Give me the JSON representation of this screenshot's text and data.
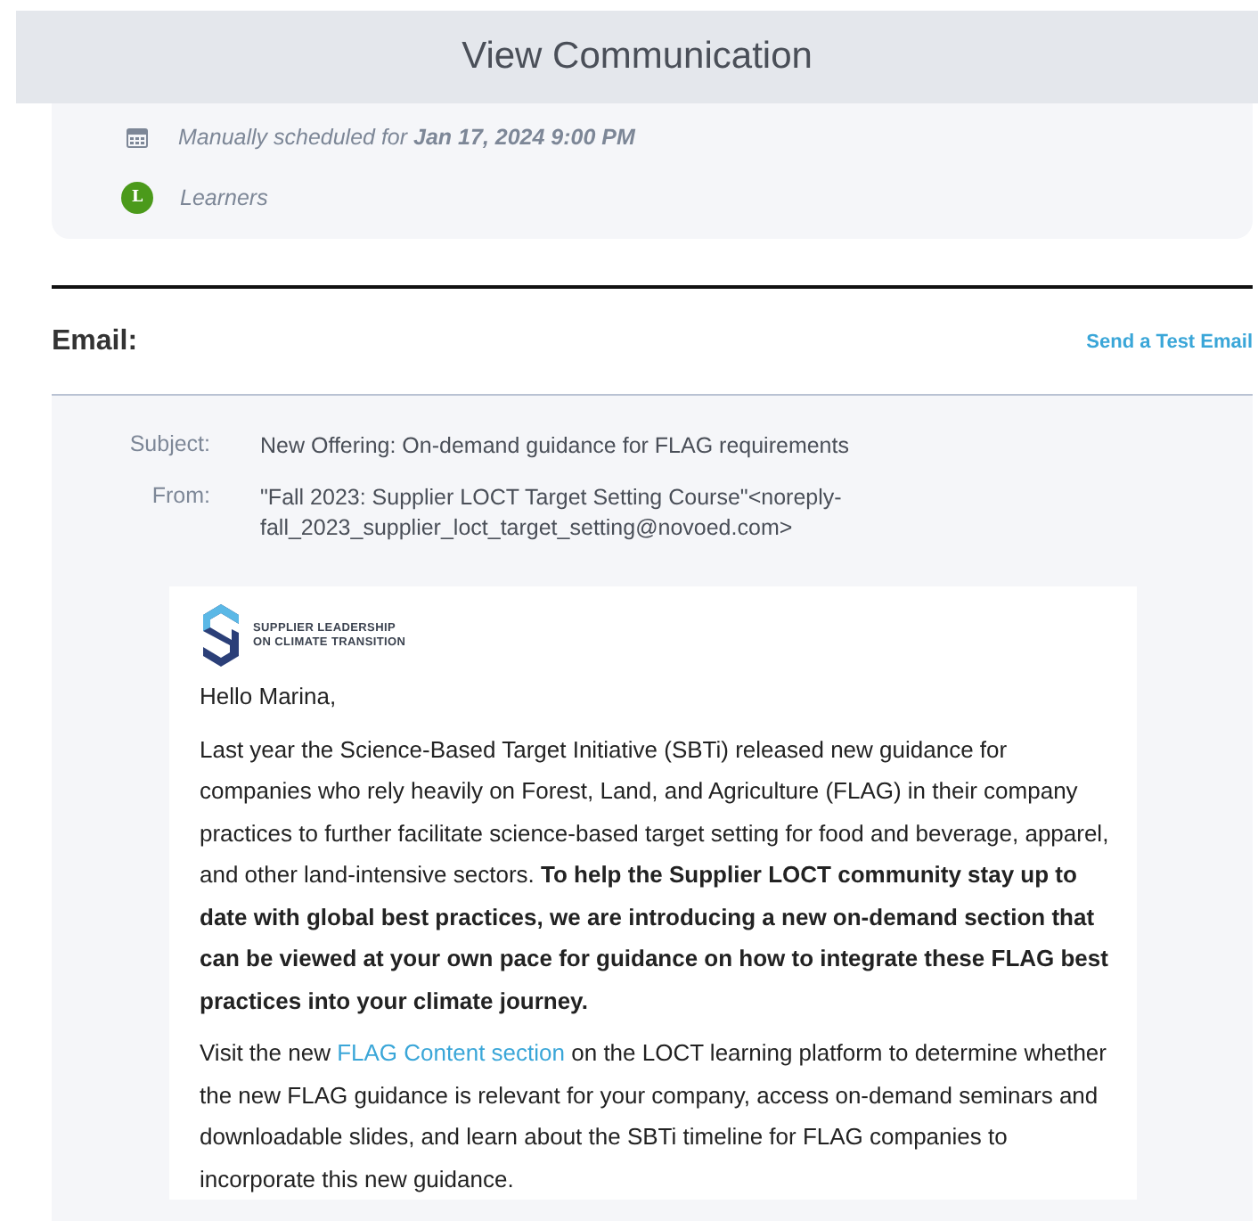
{
  "header": {
    "title": "View Communication"
  },
  "summary": {
    "schedule": "Manually scheduled for **Jan 17, 2024 9:00 PM**",
    "recipient_badge": "L",
    "recipients": "Learners"
  },
  "email": {
    "heading": "Email:",
    "test_link": "Send a Test Email",
    "fields": [
      {
        "label": "Subject:",
        "value": "New Offering: On-demand guidance for FLAG requirements"
      },
      {
        "label": "From:",
        "value": "\"Fall 2023: Supplier LOCT Target Setting Course\"<noreply-fall_2023_supplier_loct_target_setting@novoed.com>"
      }
    ],
    "body": {
      "logo_lines": [
        "SUPPLIER LEADERSHIP",
        "ON CLIMATE TRANSITION"
      ],
      "greeting": "Hello Marina,",
      "paragraph_1": "Last year the Science-Based Target Initiative (SBTi) released new guidance for companies who rely heavily on Forest, Land, and Agriculture (FLAG) in their company practices to further facilitate science-based target setting for food and beverage, apparel, and other land-intensive sectors. **To help the Supplier LOCT community stay up to date with global best practices, we are introducing a new on-demand section that can be viewed at your own pace for guidance on how to integrate these FLAG best practices into your climate journey.**",
      "paragraph_2": {
        "before": "Visit the new",
        "link": "FLAG Content section",
        "after": "on the LOCT learning platform to determine whether the new FLAG guidance is relevant for your company, access on-demand seminars and downloadable slides, and learn about the SBTi timeline for FLAG companies to incorporate this new guidance."
      }
    }
  }
}
